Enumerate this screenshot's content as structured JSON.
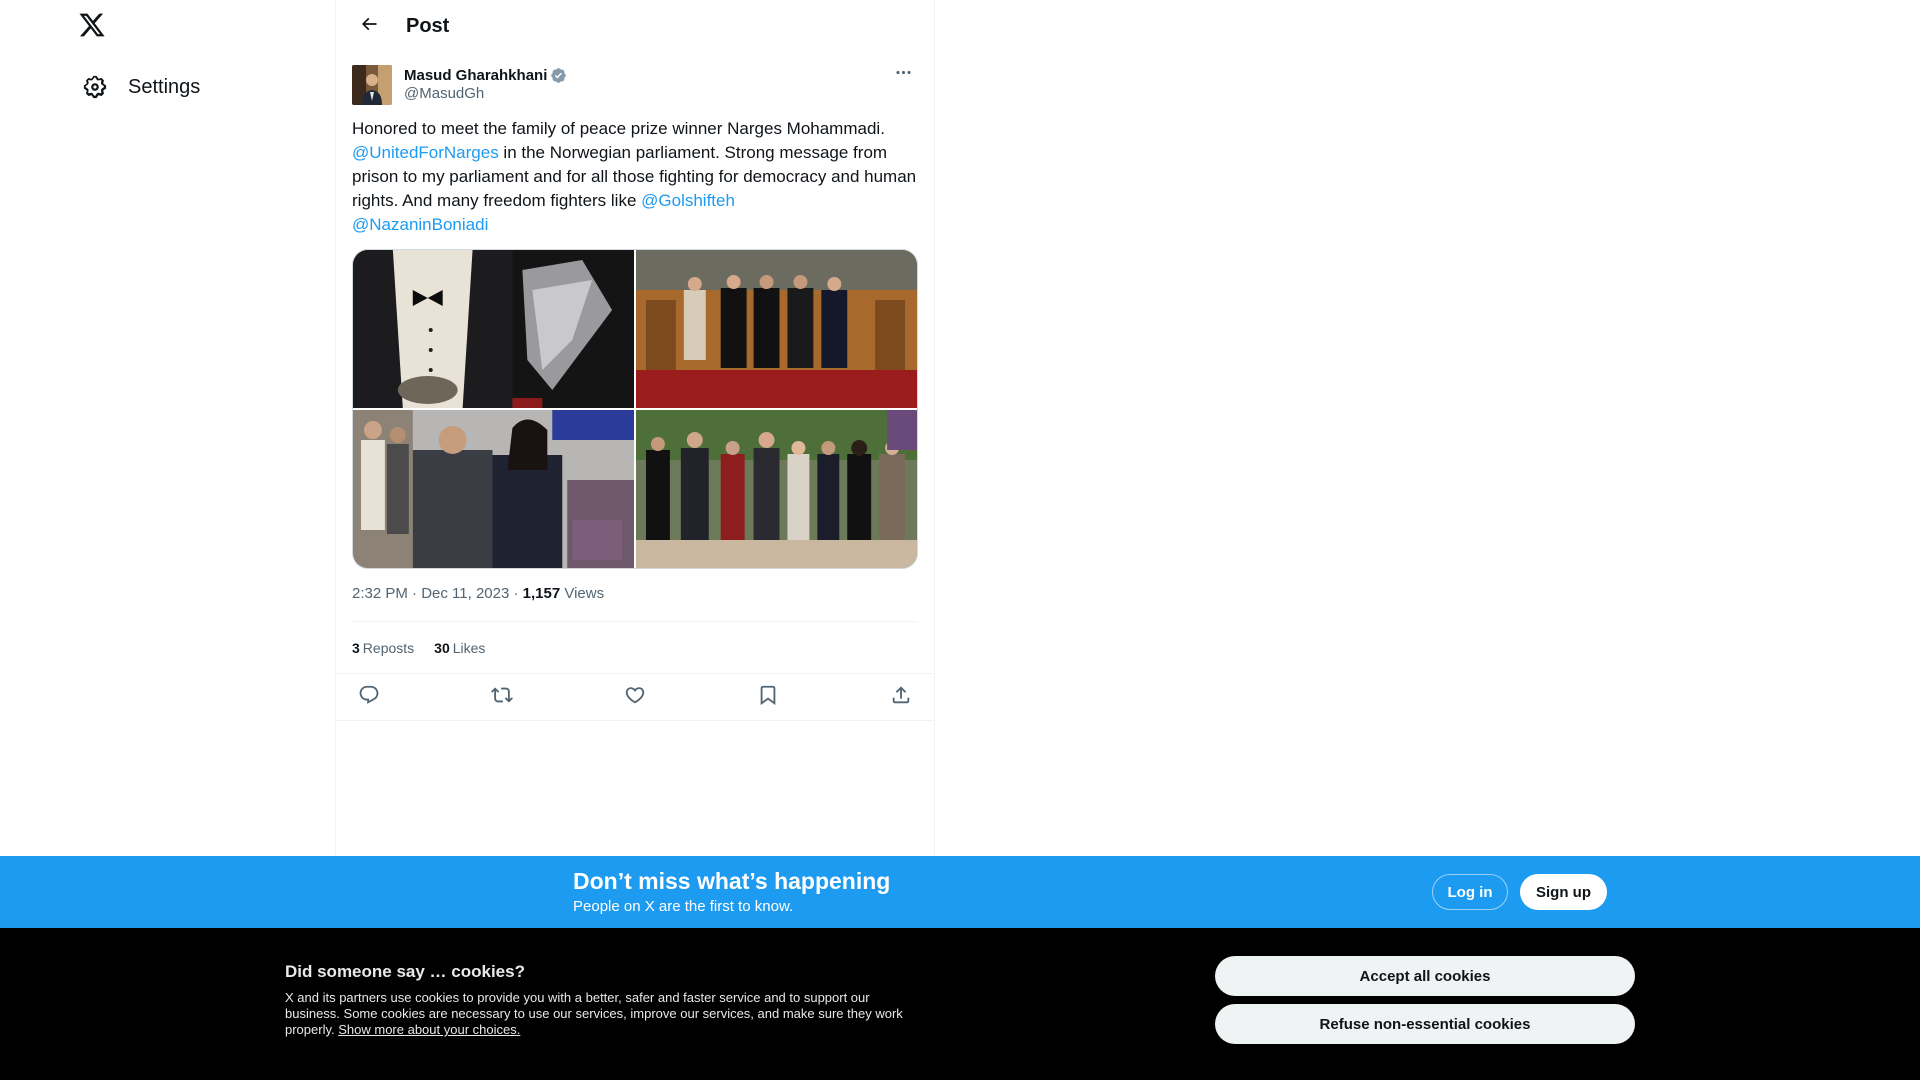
{
  "nav": {
    "logo_icon": "x-logo-icon",
    "settings_label": "Settings"
  },
  "header": {
    "title": "Post"
  },
  "post": {
    "author_name": "Masud Gharahkhani",
    "author_handle": "@MasudGh",
    "text_part1": "Honored to meet the family of peace prize winner Narges Mohammadi. ",
    "mention1": "@UnitedForNarges",
    "text_part2": " in the Norwegian parliament. Strong message from prison to my parliament and for all those fighting for democracy and human rights. And many freedom fighters like ",
    "mention2": "@Golshifteh",
    "text_part3": " ",
    "mention3": "@NazaninBoniadi",
    "time": "2:32 PM · Dec 11, 2023 · ",
    "views_count": "1,157",
    "views_label": " Views",
    "reposts_count": "3",
    "reposts_label": "Reposts",
    "likes_count": "30",
    "likes_label": "Likes"
  },
  "colors": {
    "accent": "#1d9bf0",
    "text": "#0f1419",
    "muted": "#536471"
  },
  "banner": {
    "headline": "Don’t miss what’s happening",
    "subtext": "People on X are the first to know.",
    "login_label": "Log in",
    "signup_label": "Sign up"
  },
  "cookies": {
    "title": "Did someone say … cookies?",
    "body": "X and its partners use cookies to provide you with a better, safer and faster service and to support our business. Some cookies are necessary to use our services, improve our services, and make sure they work properly. ",
    "link": "Show more about your choices.",
    "accept_label": "Accept all cookies",
    "refuse_label": "Refuse non-essential cookies"
  }
}
